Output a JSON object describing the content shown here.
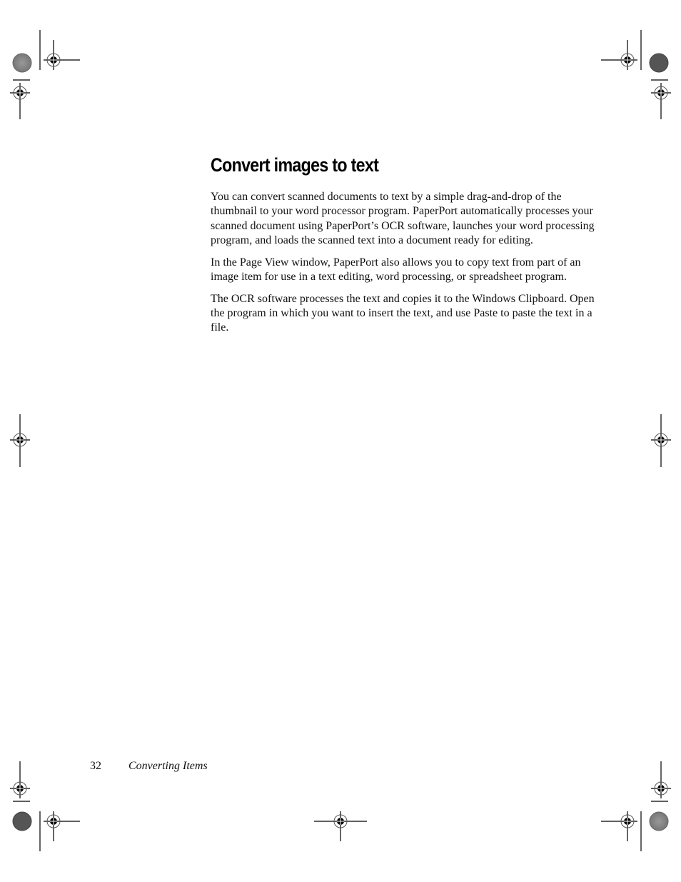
{
  "heading": "Convert images to text",
  "paragraphs": [
    "You can convert scanned documents to text by a simple drag-and-drop of the thumbnail to your word processor program. PaperPort automatically processes your scanned document using PaperPort’s OCR software, launches your word processing program, and loads the scanned text into a document ready for editing.",
    "In the Page View window, PaperPort also allows you to copy text from part of an image item for use in a text editing, word processing, or spreadsheet program.",
    "The OCR software processes the text and copies it to the Windows Clipboard. Open the program in which you want to insert the text, and use Paste to paste the text in a file."
  ],
  "footer": {
    "page_number": "32",
    "section_title": "Converting Items"
  }
}
